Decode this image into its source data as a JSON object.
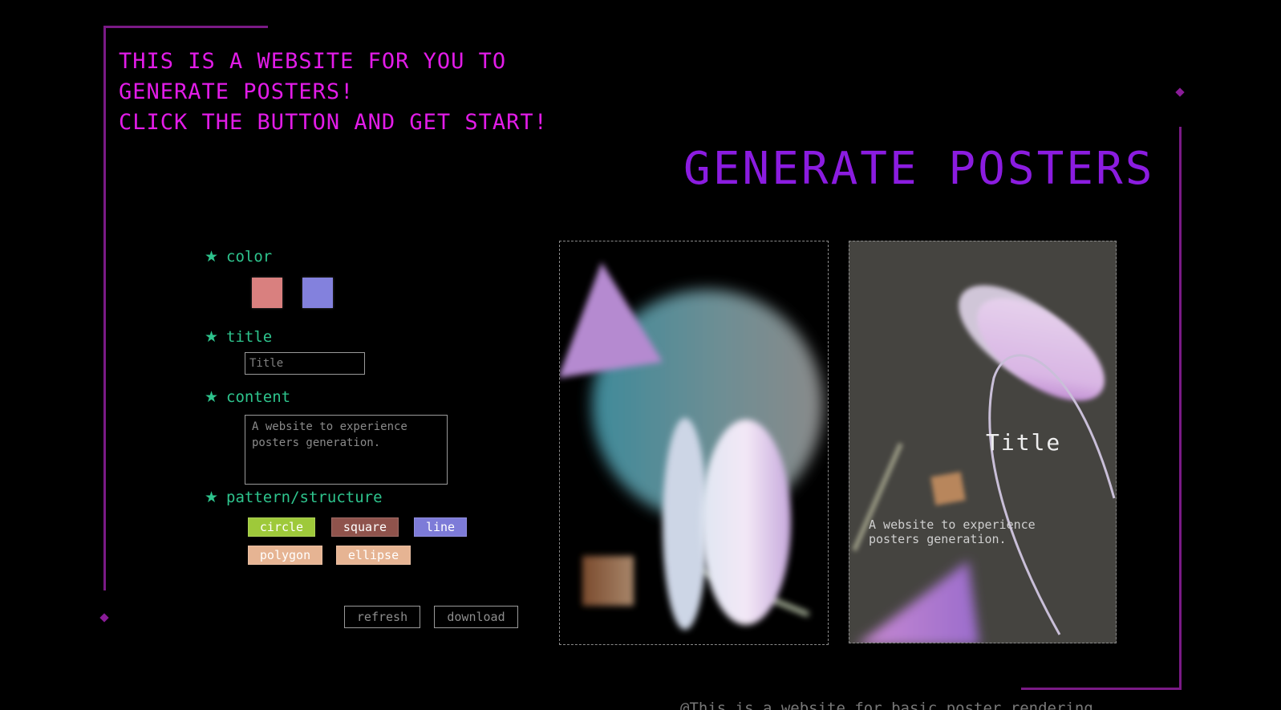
{
  "intro": {
    "line1": "THIS IS A WEBSITE FOR YOU TO",
    "line2": "GENERATE POSTERS!",
    "line3": "CLICK THE BUTTON AND GET START!"
  },
  "heading": "GENERATE POSTERS",
  "options": {
    "star": "★",
    "color_label": "color",
    "title_label": "title",
    "content_label": "content",
    "pattern_label": "pattern/structure",
    "swatches": [
      "#d9807f",
      "#8381dd"
    ],
    "title_placeholder": "Title",
    "content_placeholder": "A website to experience posters generation.",
    "patterns": [
      {
        "label": "circle",
        "color": "#9ec93a"
      },
      {
        "label": "square",
        "color": "#8f534c"
      },
      {
        "label": "line",
        "color": "#7d7bd8"
      },
      {
        "label": "polygon",
        "color": "#e6b493"
      },
      {
        "label": "ellipse",
        "color": "#e6b493"
      }
    ]
  },
  "actions": {
    "refresh": "refresh",
    "download": "download"
  },
  "poster_preview": {
    "title": "Title",
    "content": "A website to experience posters generation."
  },
  "footer": "@This is a website for basic poster rendering"
}
